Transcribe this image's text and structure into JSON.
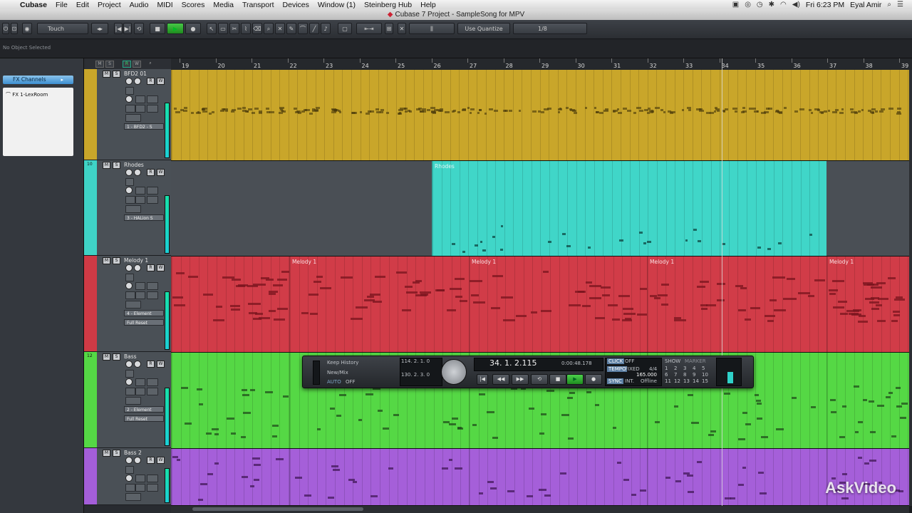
{
  "menubar": {
    "items": [
      "Cubase",
      "File",
      "Edit",
      "Project",
      "Audio",
      "MIDI",
      "Scores",
      "Media",
      "Transport",
      "Devices",
      "Window (1)",
      "Steinberg Hub",
      "Help"
    ],
    "clock": "Fri 6:23 PM",
    "user": "Eyal Amir"
  },
  "window": {
    "title": "Cubase 7 Project - SampleSong for MPV"
  },
  "toolbar": {
    "automation_mode": "Touch",
    "quantize_button": "Use Quantize",
    "quantize_value": "1/8"
  },
  "info_line": {
    "text": "No Object Selected"
  },
  "inspector": {
    "section": "FX Channels",
    "items": [
      "FX 1-LexRoom"
    ]
  },
  "ruler": {
    "bars": [
      "19",
      "20",
      "21",
      "22",
      "23",
      "24",
      "25",
      "26",
      "27",
      "28",
      "29",
      "30",
      "31",
      "32",
      "33",
      "34",
      "35",
      "36",
      "37",
      "38",
      "39"
    ]
  },
  "tracks": [
    {
      "name": "BFD2 01",
      "number": "",
      "insert": "1 - BFD2 - S",
      "color": "#c9a62a"
    },
    {
      "name": "Rhodes",
      "number": "10",
      "insert": "3 - HALion S",
      "color": "#3fd3c6"
    },
    {
      "name": "Melody 1",
      "number": "",
      "insert": "4 - Element",
      "preset": "Full Reset",
      "color": "#cf3a45"
    },
    {
      "name": "Bass",
      "number": "12",
      "insert": "2 - Element",
      "preset": "Full Reset",
      "color": "#55d845"
    },
    {
      "name": "Bass 2",
      "number": "",
      "insert": "",
      "color": "#a45ed9"
    }
  ],
  "parts": {
    "rhodes": "Rhodes",
    "melody": [
      "Melody 1",
      "Melody 1",
      "Melody 1",
      "Melody 1"
    ]
  },
  "transport": {
    "history": "Keep History",
    "mix": "New/Mix",
    "auto": "AUTO",
    "auto_state": "OFF",
    "left_locator": "114. 2. 1. 0",
    "right_locator": "130. 2. 3. 0",
    "position": "34.  1.  2.115",
    "time": "0:00:48.178",
    "click": "CLICK",
    "click_state": "OFF",
    "tempo_label": "TEMPO",
    "tempo_mode": "FIXED",
    "signature": "4/4",
    "tempo": "165.000",
    "sync": "SYNC",
    "sync_mode": "INT.",
    "sync_state": "Offline",
    "show": "SHOW",
    "marker": "MARKER",
    "marker_numbers": [
      "1",
      "2",
      "3",
      "4",
      "5",
      "6",
      "7",
      "8",
      "9",
      "10",
      "11",
      "12",
      "13",
      "14",
      "15"
    ]
  },
  "watermark": "AskVideo"
}
